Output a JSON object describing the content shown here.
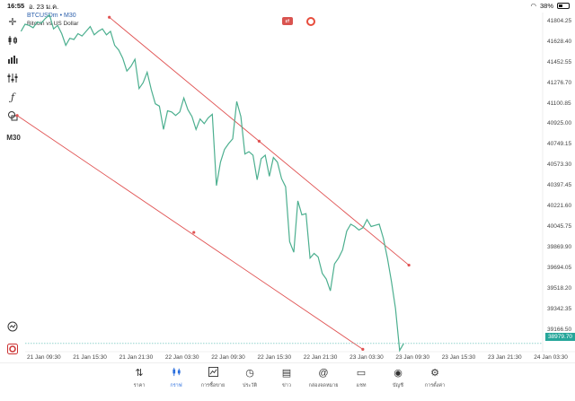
{
  "status": {
    "time": "16:55",
    "date": "อ. 23 ม.ค.",
    "battery": "38%"
  },
  "symbol": {
    "ticker": "BTCUSDm",
    "timeframe": "M30",
    "name": "Bitcoin vs US Dollar"
  },
  "left_tools": [
    "crosshair-icon",
    "candlestick-icon",
    "bar-chart-icon",
    "indicators-icon",
    "function-icon",
    "objects-icon"
  ],
  "timeframe_label": "M30",
  "current_price": "38979.70",
  "colors": {
    "line": "#4caf8f",
    "channel": "#e05252",
    "accent": "#2b6fde",
    "price_tag": "#26a69a"
  },
  "chart_data": {
    "type": "line",
    "x_ticks": [
      "21 Jan 09:30",
      "21 Jan 15:30",
      "21 Jan 21:30",
      "22 Jan 03:30",
      "22 Jan 09:30",
      "22 Jan 15:30",
      "22 Jan 21:30",
      "23 Jan 03:30",
      "23 Jan 09:30",
      "23 Jan 15:30",
      "23 Jan 21:30",
      "24 Jan 03:30"
    ],
    "y_ticks": [
      "41804.25",
      "41628.40",
      "41452.55",
      "41276.70",
      "41100.85",
      "40925.00",
      "40749.15",
      "40573.30",
      "40397.45",
      "40221.60",
      "40045.75",
      "39869.90",
      "39694.05",
      "39518.20",
      "39342.35",
      "39166.50"
    ],
    "ylim": [
      38980,
      41880
    ],
    "series": [
      {
        "values": [
          41720,
          41780,
          41770,
          41750,
          41800,
          41790,
          41830,
          41860,
          41740,
          41770,
          41700,
          41600,
          41660,
          41650,
          41700,
          41680,
          41720,
          41760,
          41690,
          41720,
          41740,
          41690,
          41720,
          41600,
          41560,
          41490,
          41380,
          41420,
          41480,
          41230,
          41280,
          41370,
          41220,
          41100,
          41080,
          40880,
          41040,
          41030,
          41000,
          41030,
          41150,
          41050,
          40990,
          40880,
          40970,
          40930,
          40980,
          41010,
          40400,
          40600,
          40710,
          40760,
          40800,
          41120,
          40990,
          40670,
          40690,
          40660,
          40450,
          40630,
          40660,
          40480,
          40640,
          40600,
          40460,
          40390,
          39920,
          39830,
          40270,
          40150,
          40160,
          39780,
          39820,
          39790,
          39650,
          39600,
          39500,
          39730,
          39780,
          39850,
          40010,
          40070,
          40050,
          40020,
          40040,
          40110,
          40050,
          40060,
          40070,
          39950,
          39780,
          39580,
          39350,
          38990,
          39050
        ]
      }
    ],
    "channel_upper": {
      "start": [
        "21 Jan 18:00",
        41840
      ],
      "mid": [
        "22 Jan 13:30",
        40780
      ],
      "end": [
        "23 Jan 09:00",
        39720
      ]
    },
    "channel_lower": {
      "start": [
        "21 Jan 06:00",
        41000
      ],
      "mid": [
        "22 Jan 05:00",
        40000
      ],
      "end": [
        "23 Jan 03:00",
        39000
      ]
    }
  },
  "nav": [
    {
      "label": "ราคา",
      "icon": "quotes-icon"
    },
    {
      "label": "กราฟ",
      "icon": "chart-icon",
      "active": true
    },
    {
      "label": "การซื้อขาย",
      "icon": "trade-icon"
    },
    {
      "label": "ประวัติ",
      "icon": "history-icon"
    },
    {
      "label": "ข่าว",
      "icon": "news-icon"
    },
    {
      "label": "กล่องจดหมาย",
      "icon": "mailbox-icon"
    },
    {
      "label": "แชท",
      "icon": "chat-icon"
    },
    {
      "label": "บัญชี",
      "icon": "account-icon"
    },
    {
      "label": "การตั้งค่า",
      "icon": "settings-icon"
    }
  ]
}
